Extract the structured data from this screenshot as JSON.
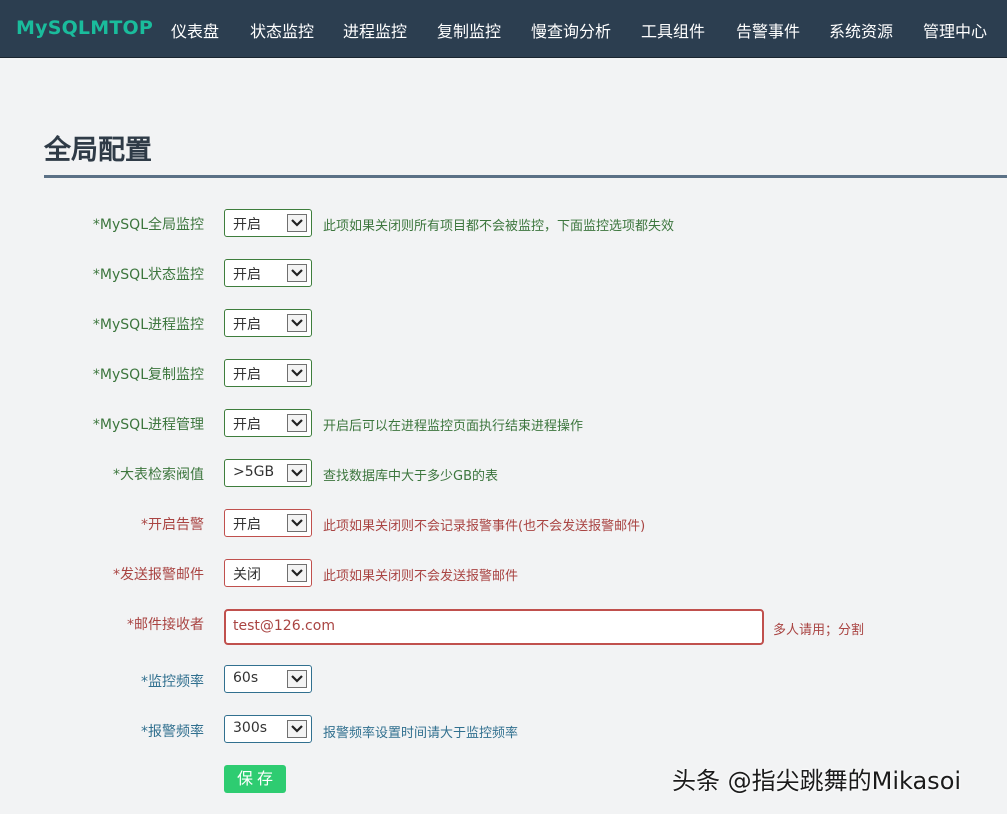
{
  "navbar": {
    "brand": "MySQLMTOP",
    "items": [
      "仪表盘",
      "状态监控",
      "进程监控",
      "复制监控",
      "慢查询分析",
      "工具组件",
      "告警事件",
      "系统资源",
      "管理中心"
    ]
  },
  "page": {
    "title": "全局配置"
  },
  "form": {
    "rows": [
      {
        "label": "*MySQL全局监控",
        "value": "开启",
        "help": "此项如果关闭则所有项目都不会被监控，下面监控选项都失效"
      },
      {
        "label": "*MySQL状态监控",
        "value": "开启",
        "help": ""
      },
      {
        "label": "*MySQL进程监控",
        "value": "开启",
        "help": ""
      },
      {
        "label": "*MySQL复制监控",
        "value": "开启",
        "help": ""
      },
      {
        "label": "*MySQL进程管理",
        "value": "开启",
        "help": "开启后可以在进程监控页面执行结束进程操作"
      },
      {
        "label": "*大表检索阀值",
        "value": ">5GB",
        "help": "查找数据库中大于多少GB的表"
      },
      {
        "label": "*开启告警",
        "value": "开启",
        "help": "此项如果关闭则不会记录报警事件(也不会发送报警邮件)"
      },
      {
        "label": "*发送报警邮件",
        "value": "关闭",
        "help": "此项如果关闭则不会发送报警邮件"
      },
      {
        "label": "*邮件接收者",
        "value": "test@126.com",
        "help": "多人请用；分割"
      },
      {
        "label": "*监控频率",
        "value": "60s",
        "help": ""
      },
      {
        "label": "*报警频率",
        "value": "300s",
        "help": "报警频率设置时间请大于监控频率"
      }
    ],
    "save_label": "保存"
  },
  "colors": {
    "navbar_bg": "#2c3e50",
    "brand": "#1abc9c",
    "success_text": "#3c763d",
    "error_text": "#a94442",
    "info_text": "#31708f",
    "save_button": "#2ecc71"
  },
  "watermark": "头条 @指尖跳舞的Mikasoi"
}
